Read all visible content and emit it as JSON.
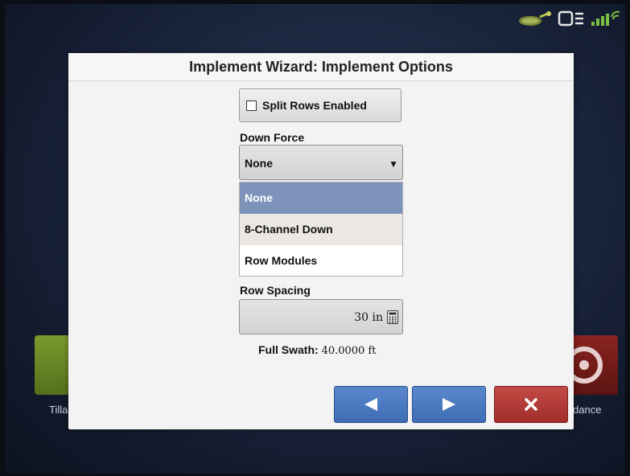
{
  "dialog": {
    "title": "Implement Wizard: Implement Options",
    "split_rows_label": "Split Rows Enabled",
    "split_rows_checked": false,
    "down_force": {
      "label": "Down Force",
      "selected": "None",
      "options": [
        "None",
        "8-Channel Down",
        "Row Modules"
      ]
    },
    "row_spacing": {
      "label": "Row Spacing",
      "value": "30 in"
    },
    "full_swath": {
      "label": "Full Swath:",
      "value": "40.0000 ft"
    }
  },
  "background": {
    "left_tile_label": "Tilla",
    "right_tile_label": "dance"
  },
  "colors": {
    "selected_option": "#7d93ba",
    "nav_blue": "#4a7ac0",
    "cancel_red": "#b03a36"
  },
  "icons": {
    "prev": "left-arrow-icon",
    "next": "right-arrow-icon",
    "cancel": "x-icon",
    "calculator": "calculator-icon"
  }
}
